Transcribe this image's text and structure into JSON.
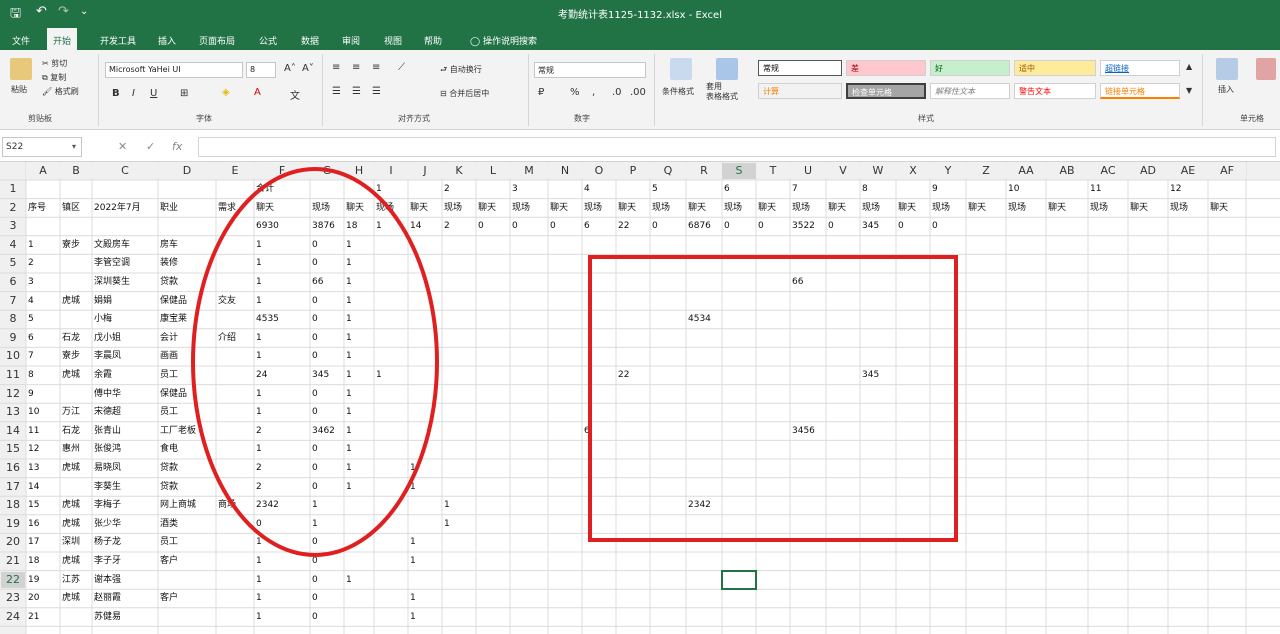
{
  "window": {
    "title": "考勤统计表1125-1132.xlsx - Excel"
  },
  "quick_access": {
    "save": "🖫",
    "undo": "↶",
    "redo": "↷",
    "more": "⌄"
  },
  "tabs": [
    "文件",
    "开始",
    "开发工具",
    "插入",
    "页面布局",
    "公式",
    "数据",
    "审阅",
    "视图",
    "帮助",
    "操作说明搜索"
  ],
  "active_tab": "开始",
  "ribbon": {
    "clipboard": {
      "paste": "粘贴",
      "cut": "剪切",
      "copy": "复制",
      "format_painter": "格式刷",
      "label": "剪贴板"
    },
    "font": {
      "name": "Microsoft YaHei UI",
      "size": "8",
      "label": "字体",
      "bold": "B",
      "italic": "I",
      "underline": "U"
    },
    "alignment": {
      "wrap": "自动换行",
      "merge": "合并后居中",
      "label": "对齐方式"
    },
    "number": {
      "format": "常规",
      "label": "数字",
      "percent": "%"
    },
    "styles": {
      "conditional": "条件格式",
      "table": "套用\n表格格式",
      "cells": [
        "常规",
        "差",
        "好",
        "适中",
        "超链接",
        "计算",
        "检查单元格",
        "解释性文本",
        "警告文本",
        "链接单元格"
      ],
      "label": "样式"
    },
    "cells_group": {
      "insert": "插入",
      "label": "单元格"
    }
  },
  "formula_bar": {
    "name_box": "S22",
    "cancel": "✕",
    "enter": "✓",
    "fx": "fx",
    "value": ""
  },
  "grid": {
    "columns": [
      "A",
      "B",
      "C",
      "D",
      "E",
      "F",
      "G",
      "H",
      "I",
      "J",
      "K",
      "L",
      "M",
      "N",
      "O",
      "P",
      "Q",
      "R",
      "S",
      "T",
      "U",
      "V",
      "W",
      "X",
      "Y",
      "Z",
      "AA",
      "AB",
      "AC",
      "AD",
      "AE",
      "AF"
    ],
    "rows": [
      "1",
      "2",
      "3",
      "4",
      "5",
      "6",
      "7",
      "8",
      "9",
      "10",
      "11",
      "12",
      "13",
      "14",
      "15",
      "16",
      "17",
      "18",
      "19",
      "20",
      "21",
      "22",
      "23",
      "24"
    ],
    "selected_cell": {
      "col": "S",
      "row": "22"
    },
    "cells": [
      {
        "c": "F",
        "r": 1,
        "v": "合计"
      },
      {
        "c": "I",
        "r": 1,
        "v": "1"
      },
      {
        "c": "K",
        "r": 1,
        "v": "2"
      },
      {
        "c": "M",
        "r": 1,
        "v": "3"
      },
      {
        "c": "O",
        "r": 1,
        "v": "4"
      },
      {
        "c": "Q",
        "r": 1,
        "v": "5"
      },
      {
        "c": "S",
        "r": 1,
        "v": "6"
      },
      {
        "c": "U",
        "r": 1,
        "v": "7"
      },
      {
        "c": "W",
        "r": 1,
        "v": "8"
      },
      {
        "c": "Y",
        "r": 1,
        "v": "9"
      },
      {
        "c": "AA",
        "r": 1,
        "v": "10"
      },
      {
        "c": "AC",
        "r": 1,
        "v": "11"
      },
      {
        "c": "AE",
        "r": 1,
        "v": "12"
      },
      {
        "c": "A",
        "r": 2,
        "v": "序号"
      },
      {
        "c": "B",
        "r": 2,
        "v": "镇区"
      },
      {
        "c": "C",
        "r": 2,
        "v": "2022年7月"
      },
      {
        "c": "D",
        "r": 2,
        "v": "职业"
      },
      {
        "c": "E",
        "r": 2,
        "v": "需求"
      },
      {
        "c": "F",
        "r": 2,
        "v": "聊天"
      },
      {
        "c": "G",
        "r": 2,
        "v": "现场"
      },
      {
        "c": "H",
        "r": 2,
        "v": "聊天"
      },
      {
        "c": "I",
        "r": 2,
        "v": "现场"
      },
      {
        "c": "J",
        "r": 2,
        "v": "聊天"
      },
      {
        "c": "K",
        "r": 2,
        "v": "现场"
      },
      {
        "c": "L",
        "r": 2,
        "v": "聊天"
      },
      {
        "c": "M",
        "r": 2,
        "v": "现场"
      },
      {
        "c": "N",
        "r": 2,
        "v": "聊天"
      },
      {
        "c": "O",
        "r": 2,
        "v": "现场"
      },
      {
        "c": "P",
        "r": 2,
        "v": "聊天"
      },
      {
        "c": "Q",
        "r": 2,
        "v": "现场"
      },
      {
        "c": "R",
        "r": 2,
        "v": "聊天"
      },
      {
        "c": "S",
        "r": 2,
        "v": "现场"
      },
      {
        "c": "T",
        "r": 2,
        "v": "聊天"
      },
      {
        "c": "U",
        "r": 2,
        "v": "现场"
      },
      {
        "c": "V",
        "r": 2,
        "v": "聊天"
      },
      {
        "c": "W",
        "r": 2,
        "v": "现场"
      },
      {
        "c": "X",
        "r": 2,
        "v": "聊天"
      },
      {
        "c": "Y",
        "r": 2,
        "v": "现场"
      },
      {
        "c": "Z",
        "r": 2,
        "v": "聊天"
      },
      {
        "c": "AA",
        "r": 2,
        "v": "现场"
      },
      {
        "c": "AB",
        "r": 2,
        "v": "聊天"
      },
      {
        "c": "AC",
        "r": 2,
        "v": "现场"
      },
      {
        "c": "AD",
        "r": 2,
        "v": "聊天"
      },
      {
        "c": "AE",
        "r": 2,
        "v": "现场"
      },
      {
        "c": "AF",
        "r": 2,
        "v": "聊天"
      },
      {
        "c": "F",
        "r": 3,
        "v": "6930"
      },
      {
        "c": "G",
        "r": 3,
        "v": "3876"
      },
      {
        "c": "H",
        "r": 3,
        "v": "18"
      },
      {
        "c": "I",
        "r": 3,
        "v": "1"
      },
      {
        "c": "J",
        "r": 3,
        "v": "14"
      },
      {
        "c": "K",
        "r": 3,
        "v": "2"
      },
      {
        "c": "L",
        "r": 3,
        "v": "0"
      },
      {
        "c": "M",
        "r": 3,
        "v": "0"
      },
      {
        "c": "N",
        "r": 3,
        "v": "0"
      },
      {
        "c": "O",
        "r": 3,
        "v": "6"
      },
      {
        "c": "P",
        "r": 3,
        "v": "22"
      },
      {
        "c": "Q",
        "r": 3,
        "v": "0"
      },
      {
        "c": "R",
        "r": 3,
        "v": "6876"
      },
      {
        "c": "S",
        "r": 3,
        "v": "0"
      },
      {
        "c": "T",
        "r": 3,
        "v": "0"
      },
      {
        "c": "U",
        "r": 3,
        "v": "3522"
      },
      {
        "c": "V",
        "r": 3,
        "v": "0"
      },
      {
        "c": "W",
        "r": 3,
        "v": "345"
      },
      {
        "c": "X",
        "r": 3,
        "v": "0"
      },
      {
        "c": "Y",
        "r": 3,
        "v": "0"
      },
      {
        "c": "A",
        "r": 4,
        "v": "1"
      },
      {
        "c": "B",
        "r": 4,
        "v": "寮步"
      },
      {
        "c": "C",
        "r": 4,
        "v": "文殿房车"
      },
      {
        "c": "D",
        "r": 4,
        "v": "房车"
      },
      {
        "c": "F",
        "r": 4,
        "v": "1"
      },
      {
        "c": "G",
        "r": 4,
        "v": "0"
      },
      {
        "c": "H",
        "r": 4,
        "v": "1"
      },
      {
        "c": "A",
        "r": 5,
        "v": "2"
      },
      {
        "c": "C",
        "r": 5,
        "v": "李管空调"
      },
      {
        "c": "D",
        "r": 5,
        "v": "装修"
      },
      {
        "c": "F",
        "r": 5,
        "v": "1"
      },
      {
        "c": "G",
        "r": 5,
        "v": "0"
      },
      {
        "c": "H",
        "r": 5,
        "v": "1"
      },
      {
        "c": "A",
        "r": 6,
        "v": "3"
      },
      {
        "c": "C",
        "r": 6,
        "v": "深圳葵生"
      },
      {
        "c": "D",
        "r": 6,
        "v": "贷款"
      },
      {
        "c": "F",
        "r": 6,
        "v": "1"
      },
      {
        "c": "G",
        "r": 6,
        "v": "66"
      },
      {
        "c": "H",
        "r": 6,
        "v": "1"
      },
      {
        "c": "U",
        "r": 6,
        "v": "66"
      },
      {
        "c": "A",
        "r": 7,
        "v": "4"
      },
      {
        "c": "B",
        "r": 7,
        "v": "虎城"
      },
      {
        "c": "C",
        "r": 7,
        "v": "娟娟"
      },
      {
        "c": "D",
        "r": 7,
        "v": "保健品"
      },
      {
        "c": "E",
        "r": 7,
        "v": "交友"
      },
      {
        "c": "F",
        "r": 7,
        "v": "1"
      },
      {
        "c": "G",
        "r": 7,
        "v": "0"
      },
      {
        "c": "H",
        "r": 7,
        "v": "1"
      },
      {
        "c": "A",
        "r": 8,
        "v": "5"
      },
      {
        "c": "C",
        "r": 8,
        "v": "小梅"
      },
      {
        "c": "D",
        "r": 8,
        "v": "康宝莱"
      },
      {
        "c": "F",
        "r": 8,
        "v": "4535"
      },
      {
        "c": "G",
        "r": 8,
        "v": "0"
      },
      {
        "c": "H",
        "r": 8,
        "v": "1"
      },
      {
        "c": "R",
        "r": 8,
        "v": "4534"
      },
      {
        "c": "A",
        "r": 9,
        "v": "6"
      },
      {
        "c": "B",
        "r": 9,
        "v": "石龙"
      },
      {
        "c": "C",
        "r": 9,
        "v": "戊小姐"
      },
      {
        "c": "D",
        "r": 9,
        "v": "会计"
      },
      {
        "c": "E",
        "r": 9,
        "v": "介绍"
      },
      {
        "c": "F",
        "r": 9,
        "v": "1"
      },
      {
        "c": "G",
        "r": 9,
        "v": "0"
      },
      {
        "c": "H",
        "r": 9,
        "v": "1"
      },
      {
        "c": "A",
        "r": 10,
        "v": "7"
      },
      {
        "c": "B",
        "r": 10,
        "v": "寮步"
      },
      {
        "c": "C",
        "r": 10,
        "v": "李晨凤"
      },
      {
        "c": "D",
        "r": 10,
        "v": "画画"
      },
      {
        "c": "F",
        "r": 10,
        "v": "1"
      },
      {
        "c": "G",
        "r": 10,
        "v": "0"
      },
      {
        "c": "H",
        "r": 10,
        "v": "1"
      },
      {
        "c": "A",
        "r": 11,
        "v": "8"
      },
      {
        "c": "B",
        "r": 11,
        "v": "虎城"
      },
      {
        "c": "C",
        "r": 11,
        "v": "余霞"
      },
      {
        "c": "D",
        "r": 11,
        "v": "员工"
      },
      {
        "c": "F",
        "r": 11,
        "v": "24"
      },
      {
        "c": "G",
        "r": 11,
        "v": "345"
      },
      {
        "c": "H",
        "r": 11,
        "v": "1"
      },
      {
        "c": "I",
        "r": 11,
        "v": "1"
      },
      {
        "c": "P",
        "r": 11,
        "v": "22"
      },
      {
        "c": "W",
        "r": 11,
        "v": "345"
      },
      {
        "c": "A",
        "r": 12,
        "v": "9"
      },
      {
        "c": "C",
        "r": 12,
        "v": "傅中华"
      },
      {
        "c": "D",
        "r": 12,
        "v": "保健品"
      },
      {
        "c": "F",
        "r": 12,
        "v": "1"
      },
      {
        "c": "G",
        "r": 12,
        "v": "0"
      },
      {
        "c": "H",
        "r": 12,
        "v": "1"
      },
      {
        "c": "A",
        "r": 13,
        "v": "10"
      },
      {
        "c": "B",
        "r": 13,
        "v": "万江"
      },
      {
        "c": "C",
        "r": 13,
        "v": "宋德超"
      },
      {
        "c": "D",
        "r": 13,
        "v": "员工"
      },
      {
        "c": "F",
        "r": 13,
        "v": "1"
      },
      {
        "c": "G",
        "r": 13,
        "v": "0"
      },
      {
        "c": "H",
        "r": 13,
        "v": "1"
      },
      {
        "c": "A",
        "r": 14,
        "v": "11"
      },
      {
        "c": "B",
        "r": 14,
        "v": "石龙"
      },
      {
        "c": "C",
        "r": 14,
        "v": "张青山"
      },
      {
        "c": "D",
        "r": 14,
        "v": "工厂老板"
      },
      {
        "c": "F",
        "r": 14,
        "v": "2"
      },
      {
        "c": "G",
        "r": 14,
        "v": "3462"
      },
      {
        "c": "H",
        "r": 14,
        "v": "1"
      },
      {
        "c": "O",
        "r": 14,
        "v": "6"
      },
      {
        "c": "U",
        "r": 14,
        "v": "3456"
      },
      {
        "c": "A",
        "r": 15,
        "v": "12"
      },
      {
        "c": "B",
        "r": 15,
        "v": "惠州"
      },
      {
        "c": "C",
        "r": 15,
        "v": "张俊鸿"
      },
      {
        "c": "D",
        "r": 15,
        "v": "食电"
      },
      {
        "c": "F",
        "r": 15,
        "v": "1"
      },
      {
        "c": "G",
        "r": 15,
        "v": "0"
      },
      {
        "c": "H",
        "r": 15,
        "v": "1"
      },
      {
        "c": "A",
        "r": 16,
        "v": "13"
      },
      {
        "c": "B",
        "r": 16,
        "v": "虎城"
      },
      {
        "c": "C",
        "r": 16,
        "v": "易晓凤"
      },
      {
        "c": "D",
        "r": 16,
        "v": "贷款"
      },
      {
        "c": "F",
        "r": 16,
        "v": "2"
      },
      {
        "c": "G",
        "r": 16,
        "v": "0"
      },
      {
        "c": "H",
        "r": 16,
        "v": "1"
      },
      {
        "c": "J",
        "r": 16,
        "v": "1"
      },
      {
        "c": "A",
        "r": 17,
        "v": "14"
      },
      {
        "c": "C",
        "r": 17,
        "v": "李葵生"
      },
      {
        "c": "D",
        "r": 17,
        "v": "贷款"
      },
      {
        "c": "F",
        "r": 17,
        "v": "2"
      },
      {
        "c": "G",
        "r": 17,
        "v": "0"
      },
      {
        "c": "H",
        "r": 17,
        "v": "1"
      },
      {
        "c": "J",
        "r": 17,
        "v": "1"
      },
      {
        "c": "A",
        "r": 18,
        "v": "15"
      },
      {
        "c": "B",
        "r": 18,
        "v": "虎城"
      },
      {
        "c": "C",
        "r": 18,
        "v": "李梅子"
      },
      {
        "c": "D",
        "r": 18,
        "v": "网上商城"
      },
      {
        "c": "E",
        "r": 18,
        "v": "商场"
      },
      {
        "c": "F",
        "r": 18,
        "v": "2342"
      },
      {
        "c": "G",
        "r": 18,
        "v": "1"
      },
      {
        "c": "K",
        "r": 18,
        "v": "1"
      },
      {
        "c": "R",
        "r": 18,
        "v": "2342"
      },
      {
        "c": "A",
        "r": 19,
        "v": "16"
      },
      {
        "c": "B",
        "r": 19,
        "v": "虎城"
      },
      {
        "c": "C",
        "r": 19,
        "v": "张少华"
      },
      {
        "c": "D",
        "r": 19,
        "v": "酒类"
      },
      {
        "c": "F",
        "r": 19,
        "v": "0"
      },
      {
        "c": "G",
        "r": 19,
        "v": "1"
      },
      {
        "c": "K",
        "r": 19,
        "v": "1"
      },
      {
        "c": "A",
        "r": 20,
        "v": "17"
      },
      {
        "c": "B",
        "r": 20,
        "v": "深圳"
      },
      {
        "c": "C",
        "r": 20,
        "v": "杨子龙"
      },
      {
        "c": "D",
        "r": 20,
        "v": "员工"
      },
      {
        "c": "F",
        "r": 20,
        "v": "1"
      },
      {
        "c": "G",
        "r": 20,
        "v": "0"
      },
      {
        "c": "J",
        "r": 20,
        "v": "1"
      },
      {
        "c": "A",
        "r": 21,
        "v": "18"
      },
      {
        "c": "B",
        "r": 21,
        "v": "虎城"
      },
      {
        "c": "C",
        "r": 21,
        "v": "李子牙"
      },
      {
        "c": "D",
        "r": 21,
        "v": "客户"
      },
      {
        "c": "F",
        "r": 21,
        "v": "1"
      },
      {
        "c": "G",
        "r": 21,
        "v": "0"
      },
      {
        "c": "J",
        "r": 21,
        "v": "1"
      },
      {
        "c": "A",
        "r": 22,
        "v": "19"
      },
      {
        "c": "B",
        "r": 22,
        "v": "江苏"
      },
      {
        "c": "C",
        "r": 22,
        "v": "谢本强"
      },
      {
        "c": "F",
        "r": 22,
        "v": "1"
      },
      {
        "c": "G",
        "r": 22,
        "v": "0"
      },
      {
        "c": "H",
        "r": 22,
        "v": "1"
      },
      {
        "c": "A",
        "r": 23,
        "v": "20"
      },
      {
        "c": "B",
        "r": 23,
        "v": "虎城"
      },
      {
        "c": "C",
        "r": 23,
        "v": "赵丽霞"
      },
      {
        "c": "D",
        "r": 23,
        "v": "客户"
      },
      {
        "c": "F",
        "r": 23,
        "v": "1"
      },
      {
        "c": "G",
        "r": 23,
        "v": "0"
      },
      {
        "c": "J",
        "r": 23,
        "v": "1"
      },
      {
        "c": "A",
        "r": 24,
        "v": "21"
      },
      {
        "c": "C",
        "r": 24,
        "v": "苏健易"
      },
      {
        "c": "F",
        "r": 24,
        "v": "1"
      },
      {
        "c": "G",
        "r": 24,
        "v": "0"
      },
      {
        "c": "J",
        "r": 24,
        "v": "1"
      }
    ]
  },
  "colors": {
    "excel_green": "#217346",
    "annotation_red": "#e02020",
    "gridline": "#dcdcdc",
    "header_bg": "#f0f0f0"
  }
}
